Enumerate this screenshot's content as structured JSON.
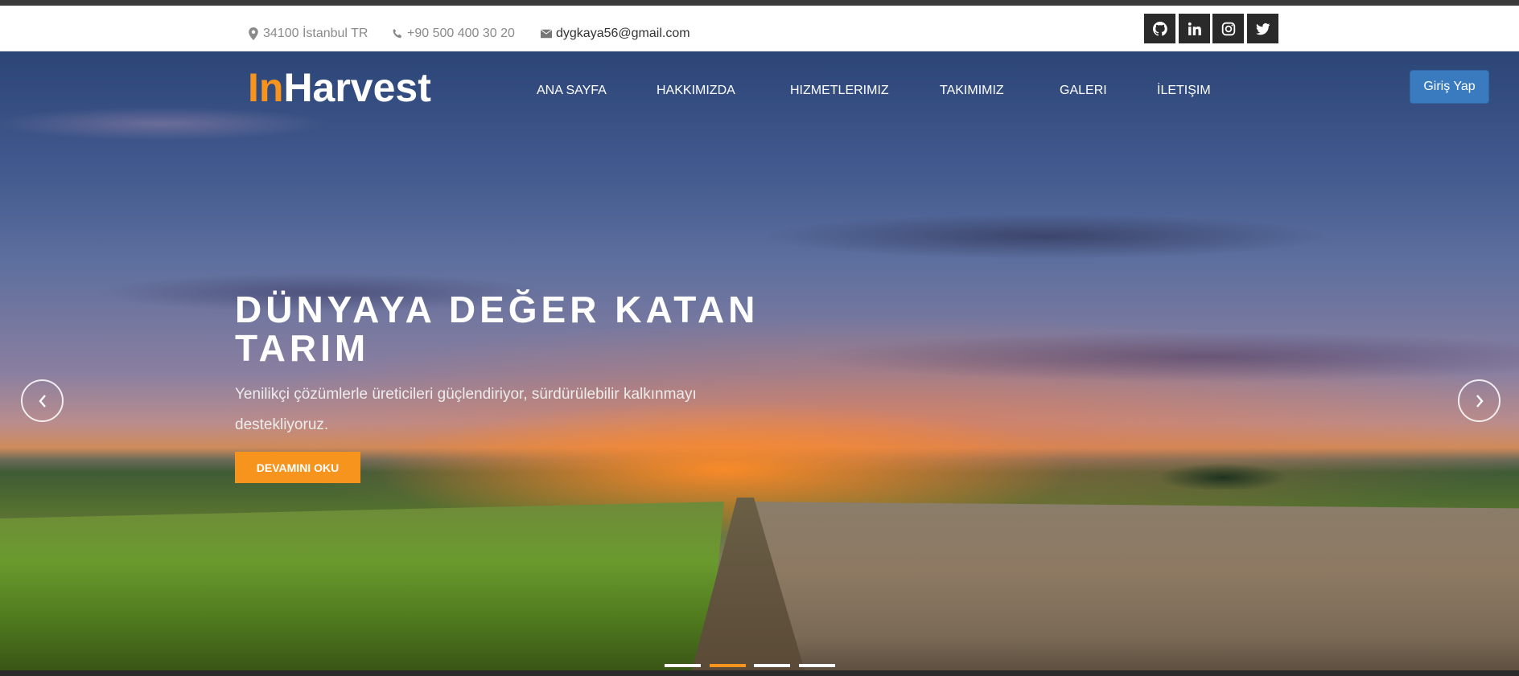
{
  "topbar": {
    "address": "34100 İstanbul TR",
    "phone": "+90 500 400 30 20",
    "email": "dygkaya56@gmail.com",
    "social": [
      "github-icon",
      "linkedin-icon",
      "instagram-icon",
      "twitter-icon"
    ]
  },
  "logo": {
    "part1": "In",
    "part2": "Harvest"
  },
  "nav": {
    "items": [
      "ANA SAYFA",
      "HAKKIMIZDA",
      "HIZMETLERIMIZ",
      "TAKIMIMIZ",
      "GALERI",
      "İLETIŞIM"
    ]
  },
  "login": {
    "label": "Giriş Yap"
  },
  "hero": {
    "title_line1": "DÜNYAYA DEĞER KATAN",
    "title_line2": "TARIM",
    "subtitle_line1": "Yenilikçi çözümlerle üreticileri güçlendiriyor, sürdürülebilir kalkınmayı",
    "subtitle_line2": "destekliyoruz.",
    "cta": "DEVAMINI OKU"
  },
  "carousel": {
    "slides": 4,
    "active_index": 1
  },
  "colors": {
    "accent": "#f7941d",
    "login_button": "#3a7bbf",
    "social_bg": "#2a2a2a"
  }
}
